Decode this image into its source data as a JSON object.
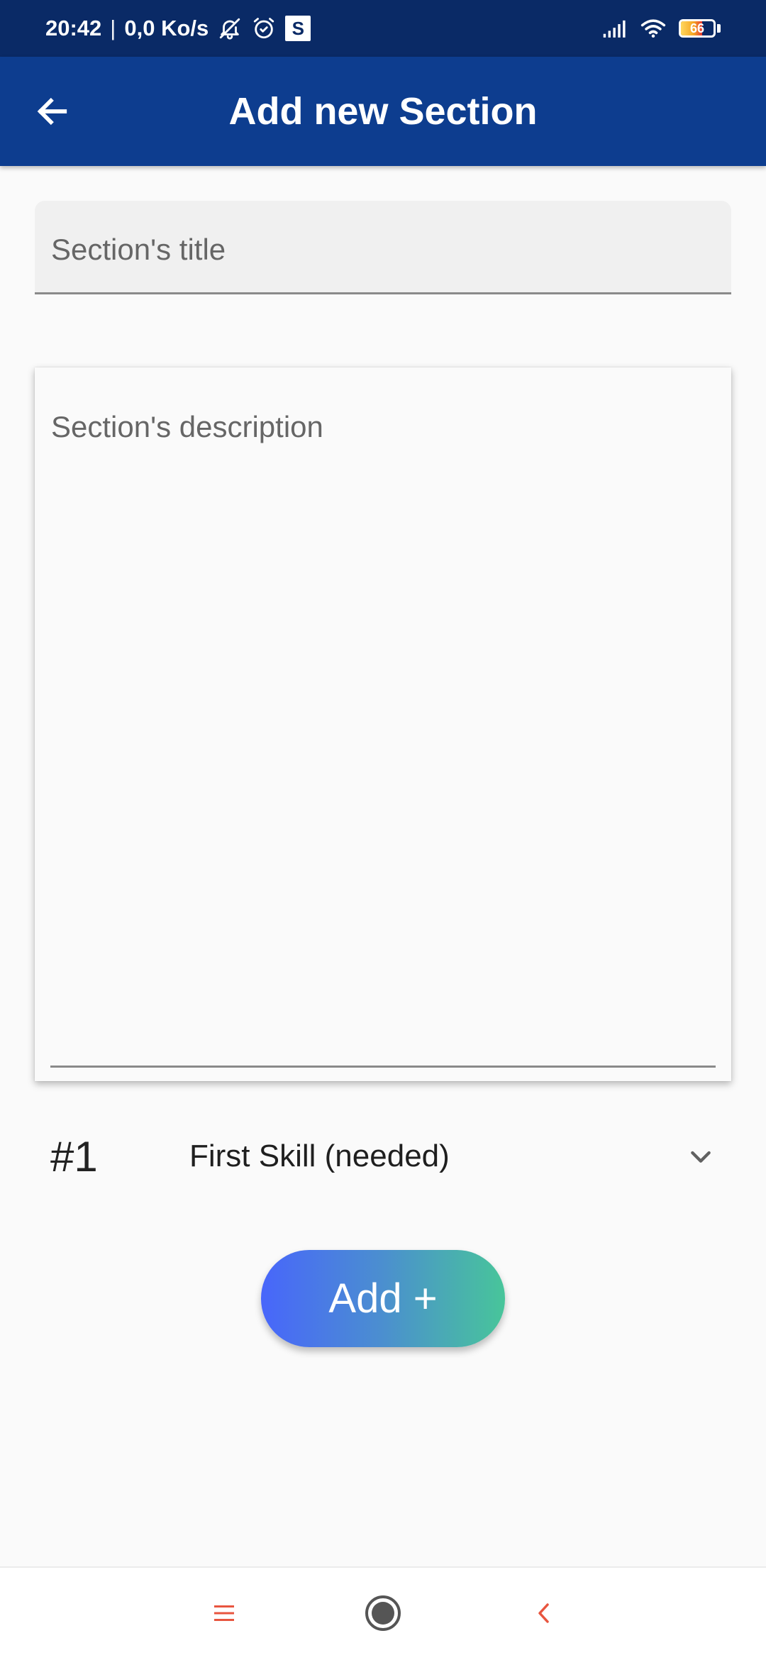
{
  "status_bar": {
    "time": "20:42",
    "separator": "|",
    "speed": "0,0 Ko/s",
    "app_badge": "S",
    "battery_level": "66",
    "icons": [
      "bell-off-icon",
      "alarm-icon",
      "s-app-icon",
      "signal-icon",
      "wifi-icon",
      "battery-icon"
    ]
  },
  "app_bar": {
    "title": "Add new Section",
    "back_icon": "arrow-left-icon"
  },
  "form": {
    "title_placeholder": "Section's title",
    "title_value": "",
    "description_placeholder": "Section's description",
    "description_value": ""
  },
  "skill": {
    "number": "#1",
    "selected_label": "First Skill (needed)",
    "dropdown_icon": "chevron-down-icon"
  },
  "add_button": {
    "label": "Add +"
  },
  "nav_bar": {
    "icons": [
      "menu-icon",
      "home-circle-icon",
      "back-chevron-icon"
    ]
  },
  "colors": {
    "status_bar": "#0a2a66",
    "app_bar": "#0d3d8f",
    "background": "#fafafa",
    "button_gradient_start": "#4866fb",
    "button_gradient_end": "#48c59a",
    "nav_accent": "#e8553f"
  }
}
